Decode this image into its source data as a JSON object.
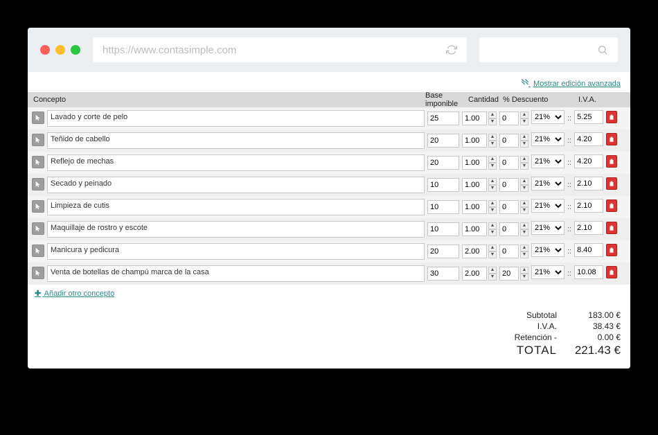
{
  "browser": {
    "url": "https://www.contasimple.com"
  },
  "advanced_link": "Mostrar edición avanzada",
  "headers": {
    "concepto": "Concepto",
    "base": "Base imponible",
    "cantidad": "Cantidad",
    "descuento": "% Descuento",
    "iva": "I.V.A."
  },
  "iva_option": "21%",
  "lines": [
    {
      "concept": "Lavado y corte de pelo",
      "base": "25",
      "qty": "1.00",
      "disc": "0",
      "iva_amount": "5.25"
    },
    {
      "concept": "Teñido de cabello",
      "base": "20",
      "qty": "1.00",
      "disc": "0",
      "iva_amount": "4.20"
    },
    {
      "concept": "Reflejo de mechas",
      "base": "20",
      "qty": "1.00",
      "disc": "0",
      "iva_amount": "4.20"
    },
    {
      "concept": "Secado y peinado",
      "base": "10",
      "qty": "1.00",
      "disc": "0",
      "iva_amount": "2.10"
    },
    {
      "concept": "Limpieza de cutis",
      "base": "10",
      "qty": "1.00",
      "disc": "0",
      "iva_amount": "2.10"
    },
    {
      "concept": "Maquillaje de rostro y escote",
      "base": "10",
      "qty": "1.00",
      "disc": "0",
      "iva_amount": "2.10"
    },
    {
      "concept": "Manicura y pedicura",
      "base": "20",
      "qty": "2.00",
      "disc": "0",
      "iva_amount": "8.40"
    },
    {
      "concept": "Venta de botellas de champú marca de la casa",
      "base": "30",
      "qty": "2.00",
      "disc": "20",
      "iva_amount": "10.08"
    }
  ],
  "add_concept": "Añadir otro concepto",
  "totals": {
    "subtotal_label": "Subtotal",
    "subtotal": "183.00 €",
    "iva_label": "I.V.A.",
    "iva": "38.43 €",
    "ret_label": "Retención -",
    "ret": "0.00 €",
    "total_label": "TOTAL",
    "total": "221.43 €"
  }
}
